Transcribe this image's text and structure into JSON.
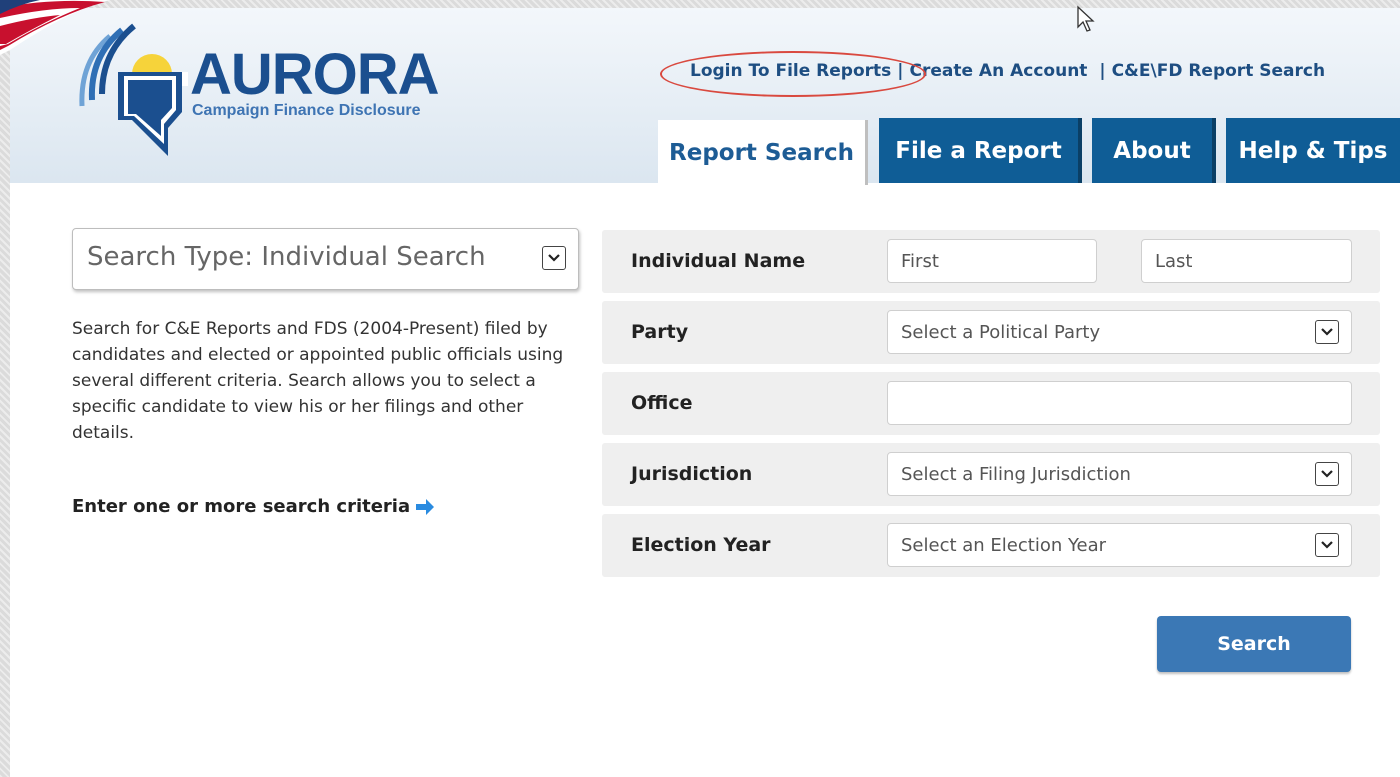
{
  "header": {
    "logo_title": "AURORA",
    "logo_subtitle": "Campaign Finance Disclosure",
    "links": {
      "login": "Login To File Reports",
      "create_account": "Create An Account",
      "report_search": "C&E\\FD Report Search"
    },
    "tabs": [
      {
        "label": "Report Search",
        "active": true
      },
      {
        "label": "File a Report",
        "active": false
      },
      {
        "label": "About",
        "active": false
      },
      {
        "label": "Help & Tips",
        "active": false
      }
    ]
  },
  "left": {
    "search_type": "Search Type: Individual Search",
    "description": "Search for C&E Reports and FDS (2004-Present) filed by candidates and elected or appointed public officials using several different criteria. Search allows you to select a specific candidate to view his or her filings and other details.",
    "criteria_prompt": "Enter one or more search criteria"
  },
  "form": {
    "individual_name": {
      "label": "Individual Name",
      "first_placeholder": "First",
      "last_placeholder": "Last"
    },
    "party": {
      "label": "Party",
      "value": "Select a Political Party"
    },
    "office": {
      "label": "Office",
      "value": ""
    },
    "jurisdiction": {
      "label": "Jurisdiction",
      "value": "Select a Filing Jurisdiction"
    },
    "election_year": {
      "label": "Election Year",
      "value": "Select an Election Year"
    },
    "search_label": "Search"
  },
  "colors": {
    "brand_blue": "#0f5d96",
    "button_blue": "#3b78b5",
    "annotation_red": "#d9493f"
  }
}
